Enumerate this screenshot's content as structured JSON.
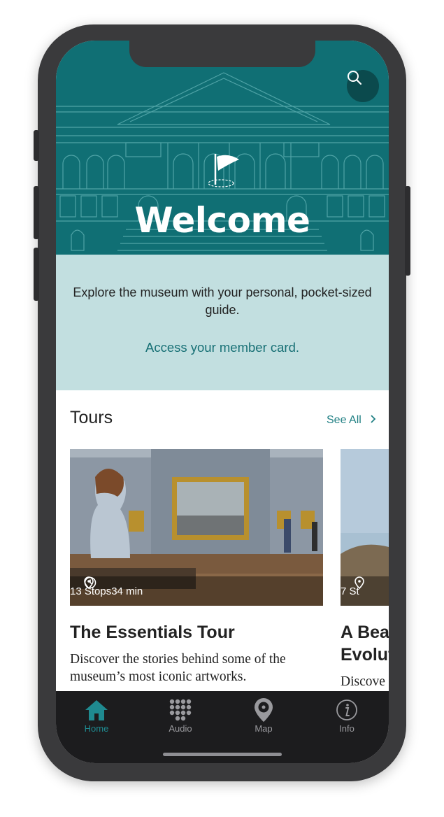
{
  "hero": {
    "title": "Welcome",
    "search_icon": "search-icon"
  },
  "intro": {
    "text": "Explore the museum with your personal, pocket-sized guide.",
    "member_link": "Access your member card."
  },
  "tours": {
    "heading": "Tours",
    "see_all": "See All",
    "cards": [
      {
        "stops": "13 Stops",
        "duration": "34 min",
        "title": "The Essentials Tour",
        "description": "Discover the stories behind some of the museum’s most iconic artworks."
      },
      {
        "stops": "7 St",
        "title_line1": "A Bea",
        "title_line2": "Evolut",
        "description": "Discove"
      }
    ]
  },
  "tabbar": {
    "items": [
      {
        "label": "Home",
        "icon": "home-icon",
        "active": true
      },
      {
        "label": "Audio",
        "icon": "keypad-icon",
        "active": false
      },
      {
        "label": "Map",
        "icon": "map-pin-icon",
        "active": false
      },
      {
        "label": "Info",
        "icon": "info-icon",
        "active": false
      }
    ]
  },
  "colors": {
    "teal": "#106f74",
    "intro_bg": "#c2dfe0",
    "link": "#177075",
    "tab_active": "#1f8a90",
    "tabbar_bg": "#1c1c1e"
  }
}
